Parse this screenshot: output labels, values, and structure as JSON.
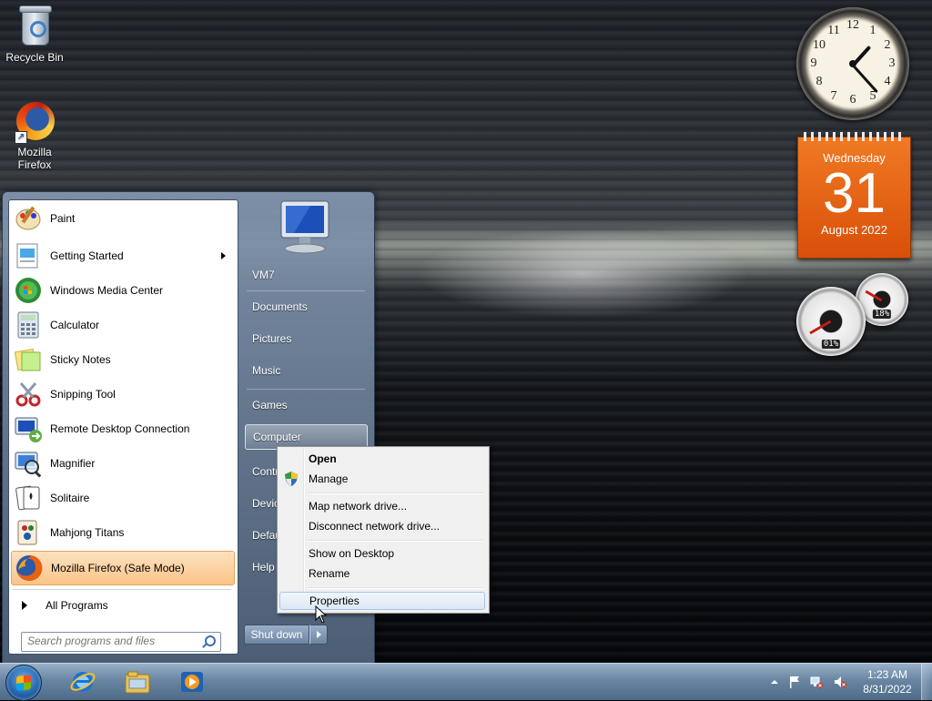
{
  "desktop": {
    "icons": [
      {
        "label": "Recycle Bin",
        "icon": "recycle-bin-icon"
      },
      {
        "label": "Mozilla Firefox",
        "icon": "firefox-icon"
      }
    ]
  },
  "gadgets": {
    "clock": {
      "numerals": [
        "12",
        "1",
        "2",
        "3",
        "4",
        "5",
        "6",
        "7",
        "8",
        "9",
        "10",
        "11"
      ]
    },
    "calendar": {
      "weekday": "Wednesday",
      "day": "31",
      "month_year": "August 2022"
    },
    "cpu_meter": {
      "cpu": "01%",
      "memory": "18%"
    }
  },
  "start_menu": {
    "programs": [
      {
        "label": "Paint",
        "icon": "paint-icon"
      },
      {
        "label": "Getting Started",
        "icon": "getting-started-icon",
        "has_submenu": true
      },
      {
        "label": "Windows Media Center",
        "icon": "media-center-icon"
      },
      {
        "label": "Calculator",
        "icon": "calculator-icon"
      },
      {
        "label": "Sticky Notes",
        "icon": "sticky-notes-icon"
      },
      {
        "label": "Snipping Tool",
        "icon": "snipping-tool-icon"
      },
      {
        "label": "Remote Desktop Connection",
        "icon": "remote-desktop-icon"
      },
      {
        "label": "Magnifier",
        "icon": "magnifier-icon"
      },
      {
        "label": "Solitaire",
        "icon": "solitaire-icon"
      },
      {
        "label": "Mahjong Titans",
        "icon": "mahjong-icon"
      },
      {
        "label": "Mozilla Firefox (Safe Mode)",
        "icon": "firefox-icon",
        "selected": true
      }
    ],
    "all_programs": "All Programs",
    "search_placeholder": "Search programs and files",
    "right_items": [
      "VM7",
      "Documents",
      "Pictures",
      "Music",
      "Games",
      "Computer",
      "Contr",
      "Devic",
      "Defau",
      "Help"
    ],
    "shutdown": "Shut down"
  },
  "context_menu": {
    "items": [
      {
        "label": "Open",
        "bold": true
      },
      {
        "label": "Manage",
        "icon": "uac-shield-icon"
      },
      {
        "label": "Map network drive..."
      },
      {
        "label": "Disconnect network drive..."
      },
      {
        "label": "Show on Desktop"
      },
      {
        "label": "Rename"
      },
      {
        "label": "Properties",
        "hovered": true
      }
    ]
  },
  "taskbar": {
    "pinned": [
      "internet-explorer-icon",
      "windows-explorer-icon",
      "media-player-icon"
    ],
    "time": "1:23 AM",
    "date": "8/31/2022"
  },
  "colors": {
    "selection": "#fbc487",
    "calendar": "#e8620f",
    "taskbar": "#7a98b8"
  }
}
